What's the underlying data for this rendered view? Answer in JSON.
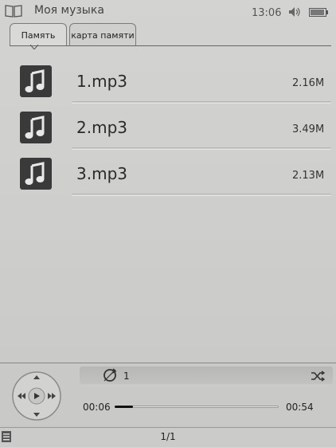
{
  "status": {
    "title": "Моя музыка",
    "time": "13:06",
    "icons": [
      "book-icon",
      "speaker-icon",
      "battery-icon"
    ]
  },
  "tabs": [
    {
      "label": "Память",
      "active": true
    },
    {
      "label": "карта памяти",
      "active": false
    }
  ],
  "files": [
    {
      "name": "1.mp3",
      "size": "2.16M",
      "icon": "music-note-icon"
    },
    {
      "name": "2.mp3",
      "size": "3.49M",
      "icon": "music-note-icon"
    },
    {
      "name": "3.mp3",
      "size": "2.13M",
      "icon": "music-note-icon"
    }
  ],
  "player": {
    "track_number": "1",
    "current_time": "00:06",
    "total_time": "00:54",
    "progress_fraction": 0.11,
    "icons": [
      "dpad-icon",
      "repeat-icon",
      "shuffle-icon"
    ]
  },
  "footer": {
    "page": "1/1"
  },
  "colors": {
    "screen": "#cfcfcd",
    "icon_tile": "#3a3a3a",
    "progress_fill": "#111111"
  }
}
